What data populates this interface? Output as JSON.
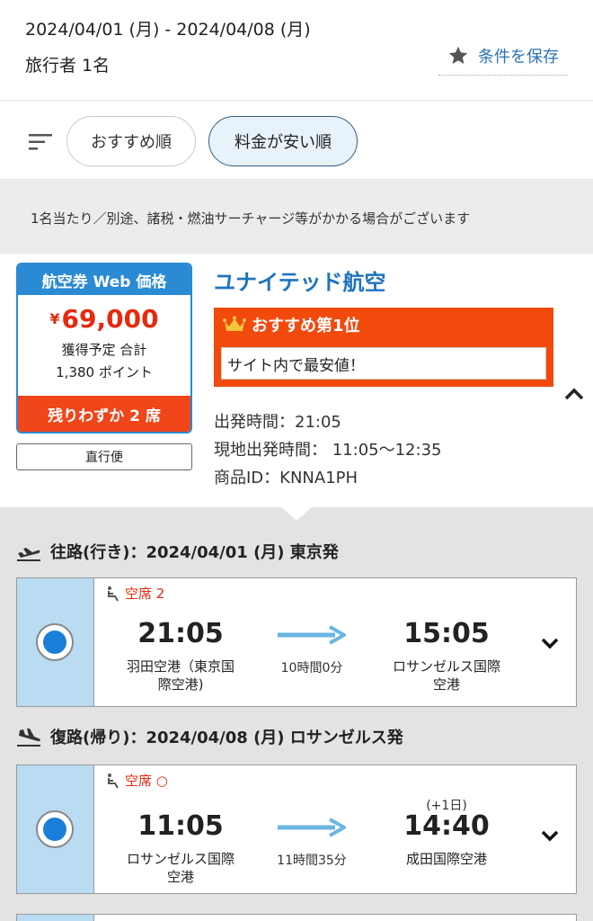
{
  "search": {
    "date_range": "2024/04/01 (月) - 2024/04/08 (月)",
    "travelers": "旅行者 1名",
    "save_label": "条件を保存"
  },
  "sort": {
    "options": [
      "おすすめ順",
      "料金が安い順"
    ],
    "selected": "料金が安い順"
  },
  "notice": "1名当たり／別途、諸税・燃油サーチャージ等がかかる場合がございます",
  "result": {
    "price_header": "航空券 Web 価格",
    "currency": "¥",
    "price": "69,000",
    "points_line1": "獲得予定 合計",
    "points_line2": "1,380 ポイント",
    "seats_left": "残りわずか 2 席",
    "nonstop_label": "直行便",
    "airline": "ユナイテッド航空",
    "recommend_title": "おすすめ第1位",
    "recommend_text": "サイト内で最安値！",
    "departure_time_line": "出発時間：21:05",
    "local_departure_line": "現地出発時間： 11:05〜12:35",
    "product_id_line": "商品ID：KNNA1PH"
  },
  "outbound": {
    "heading": "往路(行き)：2024/04/01  (月) 東京発",
    "seat_label": "空席 2",
    "dep_time": "21:05",
    "dep_airport_1": "羽田空港（東京国",
    "dep_airport_2": "際空港)",
    "duration": "10時間0分",
    "arr_time": "15:05",
    "arr_airport_1": "ロサンゼルス国際",
    "arr_airport_2": "空港"
  },
  "inbound": {
    "heading": "復路(帰り)：2024/04/08  (月) ロサンゼルス発",
    "seat_label": "空席 ○",
    "dep_time": "11:05",
    "dep_airport_1": "ロサンゼルス国際",
    "dep_airport_2": "空港",
    "duration": "11時間35分",
    "day_offset": "(+1日)",
    "arr_time": "14:40",
    "arr_airport_1": "成田国際空港"
  },
  "colors": {
    "accent_blue": "#1f73bd",
    "price_red": "#e52a0e",
    "banner_orange": "#f24a0c",
    "selected_bg": "#b9dcf3"
  },
  "icons": [
    "star-icon",
    "sort-icon",
    "crown-icon",
    "chevron-up-icon",
    "departure-plane-icon",
    "arrival-plane-icon",
    "wheelchair-seat-icon",
    "right-arrow-icon",
    "chevron-down-icon"
  ]
}
